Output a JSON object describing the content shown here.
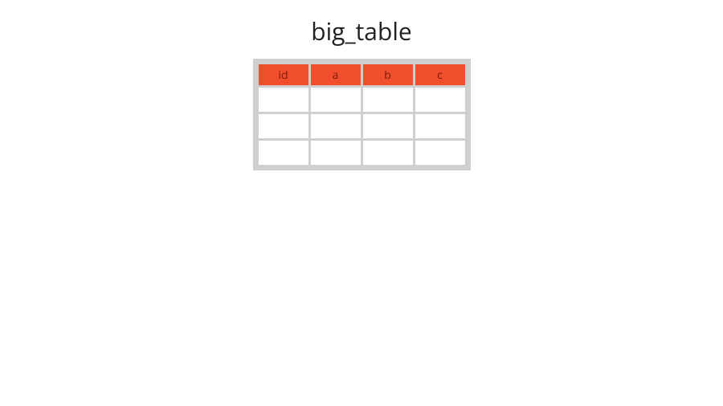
{
  "chart_data": {
    "type": "table",
    "title": "big_table",
    "columns": [
      "id",
      "a",
      "b",
      "c"
    ],
    "rows": [
      [
        "",
        "",
        "",
        ""
      ],
      [
        "",
        "",
        "",
        ""
      ],
      [
        "",
        "",
        "",
        ""
      ]
    ]
  }
}
